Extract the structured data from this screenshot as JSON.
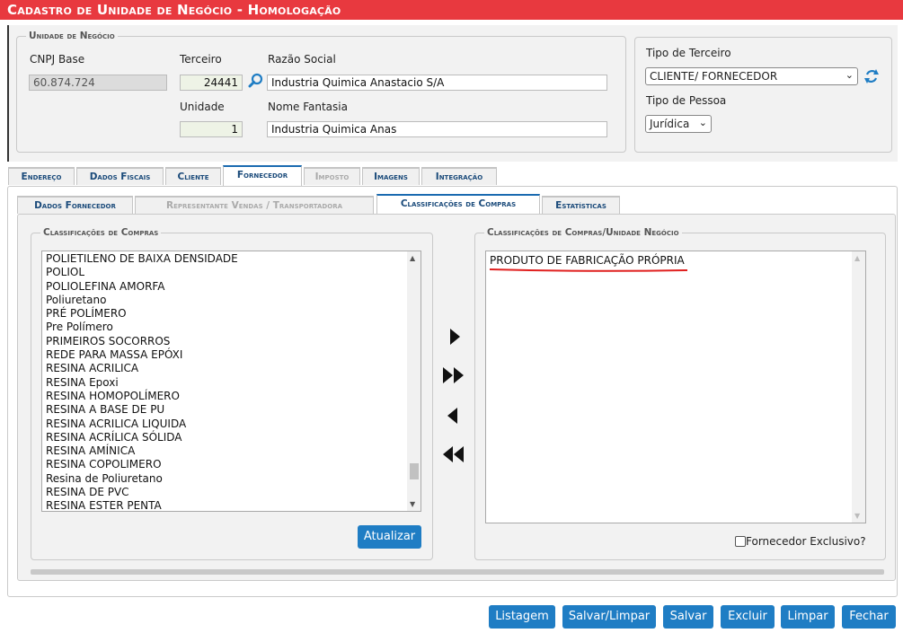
{
  "title": "Cadastro de Unidade de Negócio  - Homologação",
  "unidade": {
    "legend": "Unidade de Negócio",
    "cnpj_label": "CNPJ Base",
    "cnpj_value": "60.874.724",
    "terceiro_label": "Terceiro",
    "terceiro_value": "24441",
    "razao_label": "Razão Social",
    "razao_value": "Industria Quimica Anastacio S/A",
    "unidade_label": "Unidade",
    "unidade_value": "1",
    "fantasia_label": "Nome Fantasia",
    "fantasia_value": "Industria Quimica Anas"
  },
  "tipo": {
    "terceiro_label": "Tipo de Terceiro",
    "terceiro_value": "CLIENTE/ FORNECEDOR",
    "pessoa_label": "Tipo de Pessoa",
    "pessoa_value": "Jurídica"
  },
  "tabs": [
    "Endereço",
    "Dados Fiscais",
    "Cliente",
    "Fornecedor",
    "Imposto",
    "Imagens",
    "Integração"
  ],
  "subtabs": [
    "Dados Fornecedor",
    "Representante Vendas / Transportadora",
    "Classificações de Compras",
    "Estatísticas"
  ],
  "left_list": {
    "legend": "Classificações de Compras",
    "items": [
      "POLIETILENO DE BAIXA DENSIDADE",
      "POLIOL",
      "POLIOLEFINA AMORFA",
      "Poliuretano",
      "PRÉ POLÍMERO",
      "Pre Polímero",
      "PRIMEIROS SOCORROS",
      "REDE PARA MASSA EPÓXI",
      "RESINA ACRILICA",
      "RESINA Epoxi",
      "RESINA HOMOPOLÍMERO",
      "RESINA A BASE DE PU",
      "RESINA ACRILICA LIQUIDA",
      "RESINA ACRÍLICA SÓLIDA",
      "RESINA AMÍNICA",
      "RESINA COPOLIMERO",
      "Resina de Poliuretano",
      "RESINA DE PVC",
      "RESINA ESTER PENTA"
    ],
    "button": "Atualizar"
  },
  "right_list": {
    "legend": "Classificações de Compras/Unidade Negócio",
    "items": [
      "PRODUTO DE FABRICAÇÃO PRÓPRIA"
    ],
    "checkbox_label": "Fornecedor Exclusivo?"
  },
  "buttons": [
    "Listagem",
    "Salvar/Limpar",
    "Salvar",
    "Excluir",
    "Limpar",
    "Fechar"
  ],
  "colors": {
    "title_bg": "#e8393f",
    "button": "#1f7dc4",
    "underline": "#e0201f"
  }
}
